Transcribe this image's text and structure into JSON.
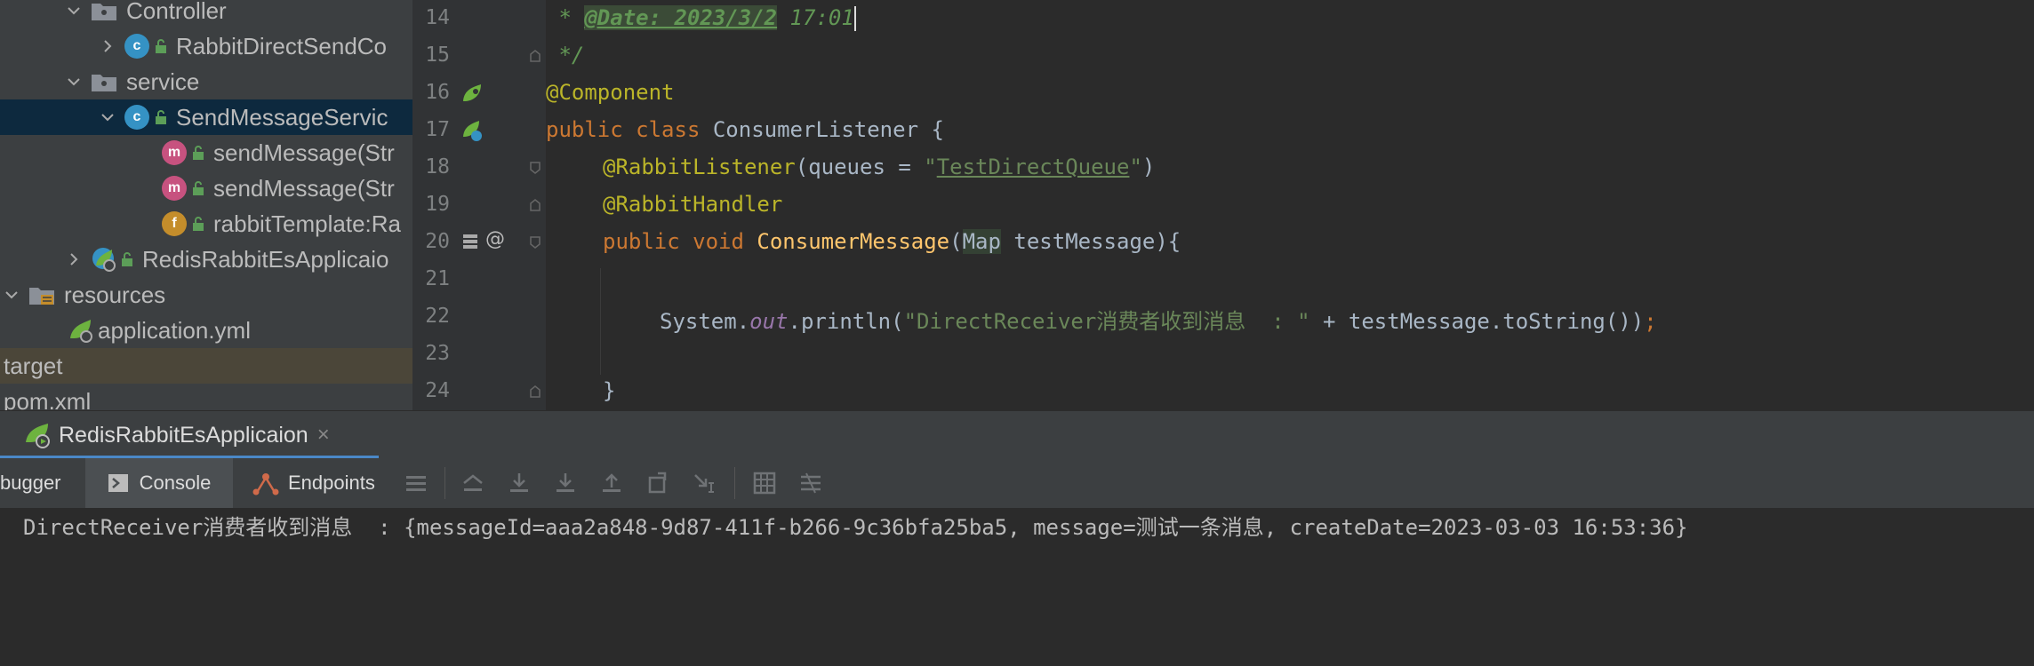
{
  "project_tree": {
    "items": [
      {
        "label": "Controller",
        "type": "folder",
        "expanded": true
      },
      {
        "label": "RabbitDirectSendCo",
        "type": "class",
        "expanded": false
      },
      {
        "label": "service",
        "type": "folder",
        "expanded": true
      },
      {
        "label": "SendMessageServic",
        "type": "class",
        "expanded": true,
        "selected": true
      },
      {
        "label": "sendMessage(Str",
        "type": "method"
      },
      {
        "label": "sendMessage(Str",
        "type": "method"
      },
      {
        "label": "rabbitTemplate:Ra",
        "type": "field"
      },
      {
        "label": "RedisRabbitEsApplicaio",
        "type": "spring-boot-class",
        "expanded": false
      },
      {
        "label": "resources",
        "type": "resources-folder",
        "expanded": true
      },
      {
        "label": "application.yml",
        "type": "yaml"
      },
      {
        "label": "target",
        "type": "excluded-folder"
      },
      {
        "label": "pom.xml",
        "type": "xml"
      }
    ]
  },
  "editor": {
    "line_numbers": [
      "14",
      "15",
      "16",
      "17",
      "18",
      "19",
      "20",
      "21",
      "22",
      "23",
      "24"
    ],
    "lines": {
      "l14": {
        "prefix": " * ",
        "tag": "@Date: 2023/3/2",
        "rest": " 17:01"
      },
      "l15": {
        "text": " */"
      },
      "l16": {
        "annotation": "@Component"
      },
      "l17": {
        "kw": "public class ",
        "name": "ConsumerListener",
        "rest": " {"
      },
      "l18": {
        "annotation": "@RabbitListener",
        "open": "(queues = ",
        "q1": "\"",
        "value": "TestDirectQueue",
        "q2": "\"",
        "close": ")"
      },
      "l19": {
        "annotation": "@RabbitHandler"
      },
      "l20": {
        "kw": "public void ",
        "method": "ConsumerMessage",
        "paren": "(",
        "type": "Map",
        "rest": " testMessage){"
      },
      "l22": {
        "obj": "System.",
        "field": "out",
        "call": ".println(",
        "string": "\"DirectReceiver消费者收到消息  : \"",
        "plus": " + testMessage.toString())",
        "semi": ";"
      },
      "l24": {
        "text": "}"
      }
    }
  },
  "run_panel": {
    "tab_label": "RedisRabbitEsApplicaion",
    "close_glyph": "×"
  },
  "toolbar": {
    "tabs": [
      {
        "label": "bugger"
      },
      {
        "label": "Console",
        "active": true
      },
      {
        "label": "Endpoints"
      }
    ]
  },
  "console": {
    "output": "DirectReceiver消费者收到消息  : {messageId=aaa2a848-9d87-411f-b266-9c36bfa25ba5, message=测试一条消息, createDate=2023-03-03 16:53:36}"
  },
  "colors": {
    "accent": "#4a88c7",
    "selection": "#0d293e",
    "keyword": "#cc7832",
    "annotation": "#bbb529",
    "string": "#6a8759",
    "method": "#ffc66d"
  }
}
